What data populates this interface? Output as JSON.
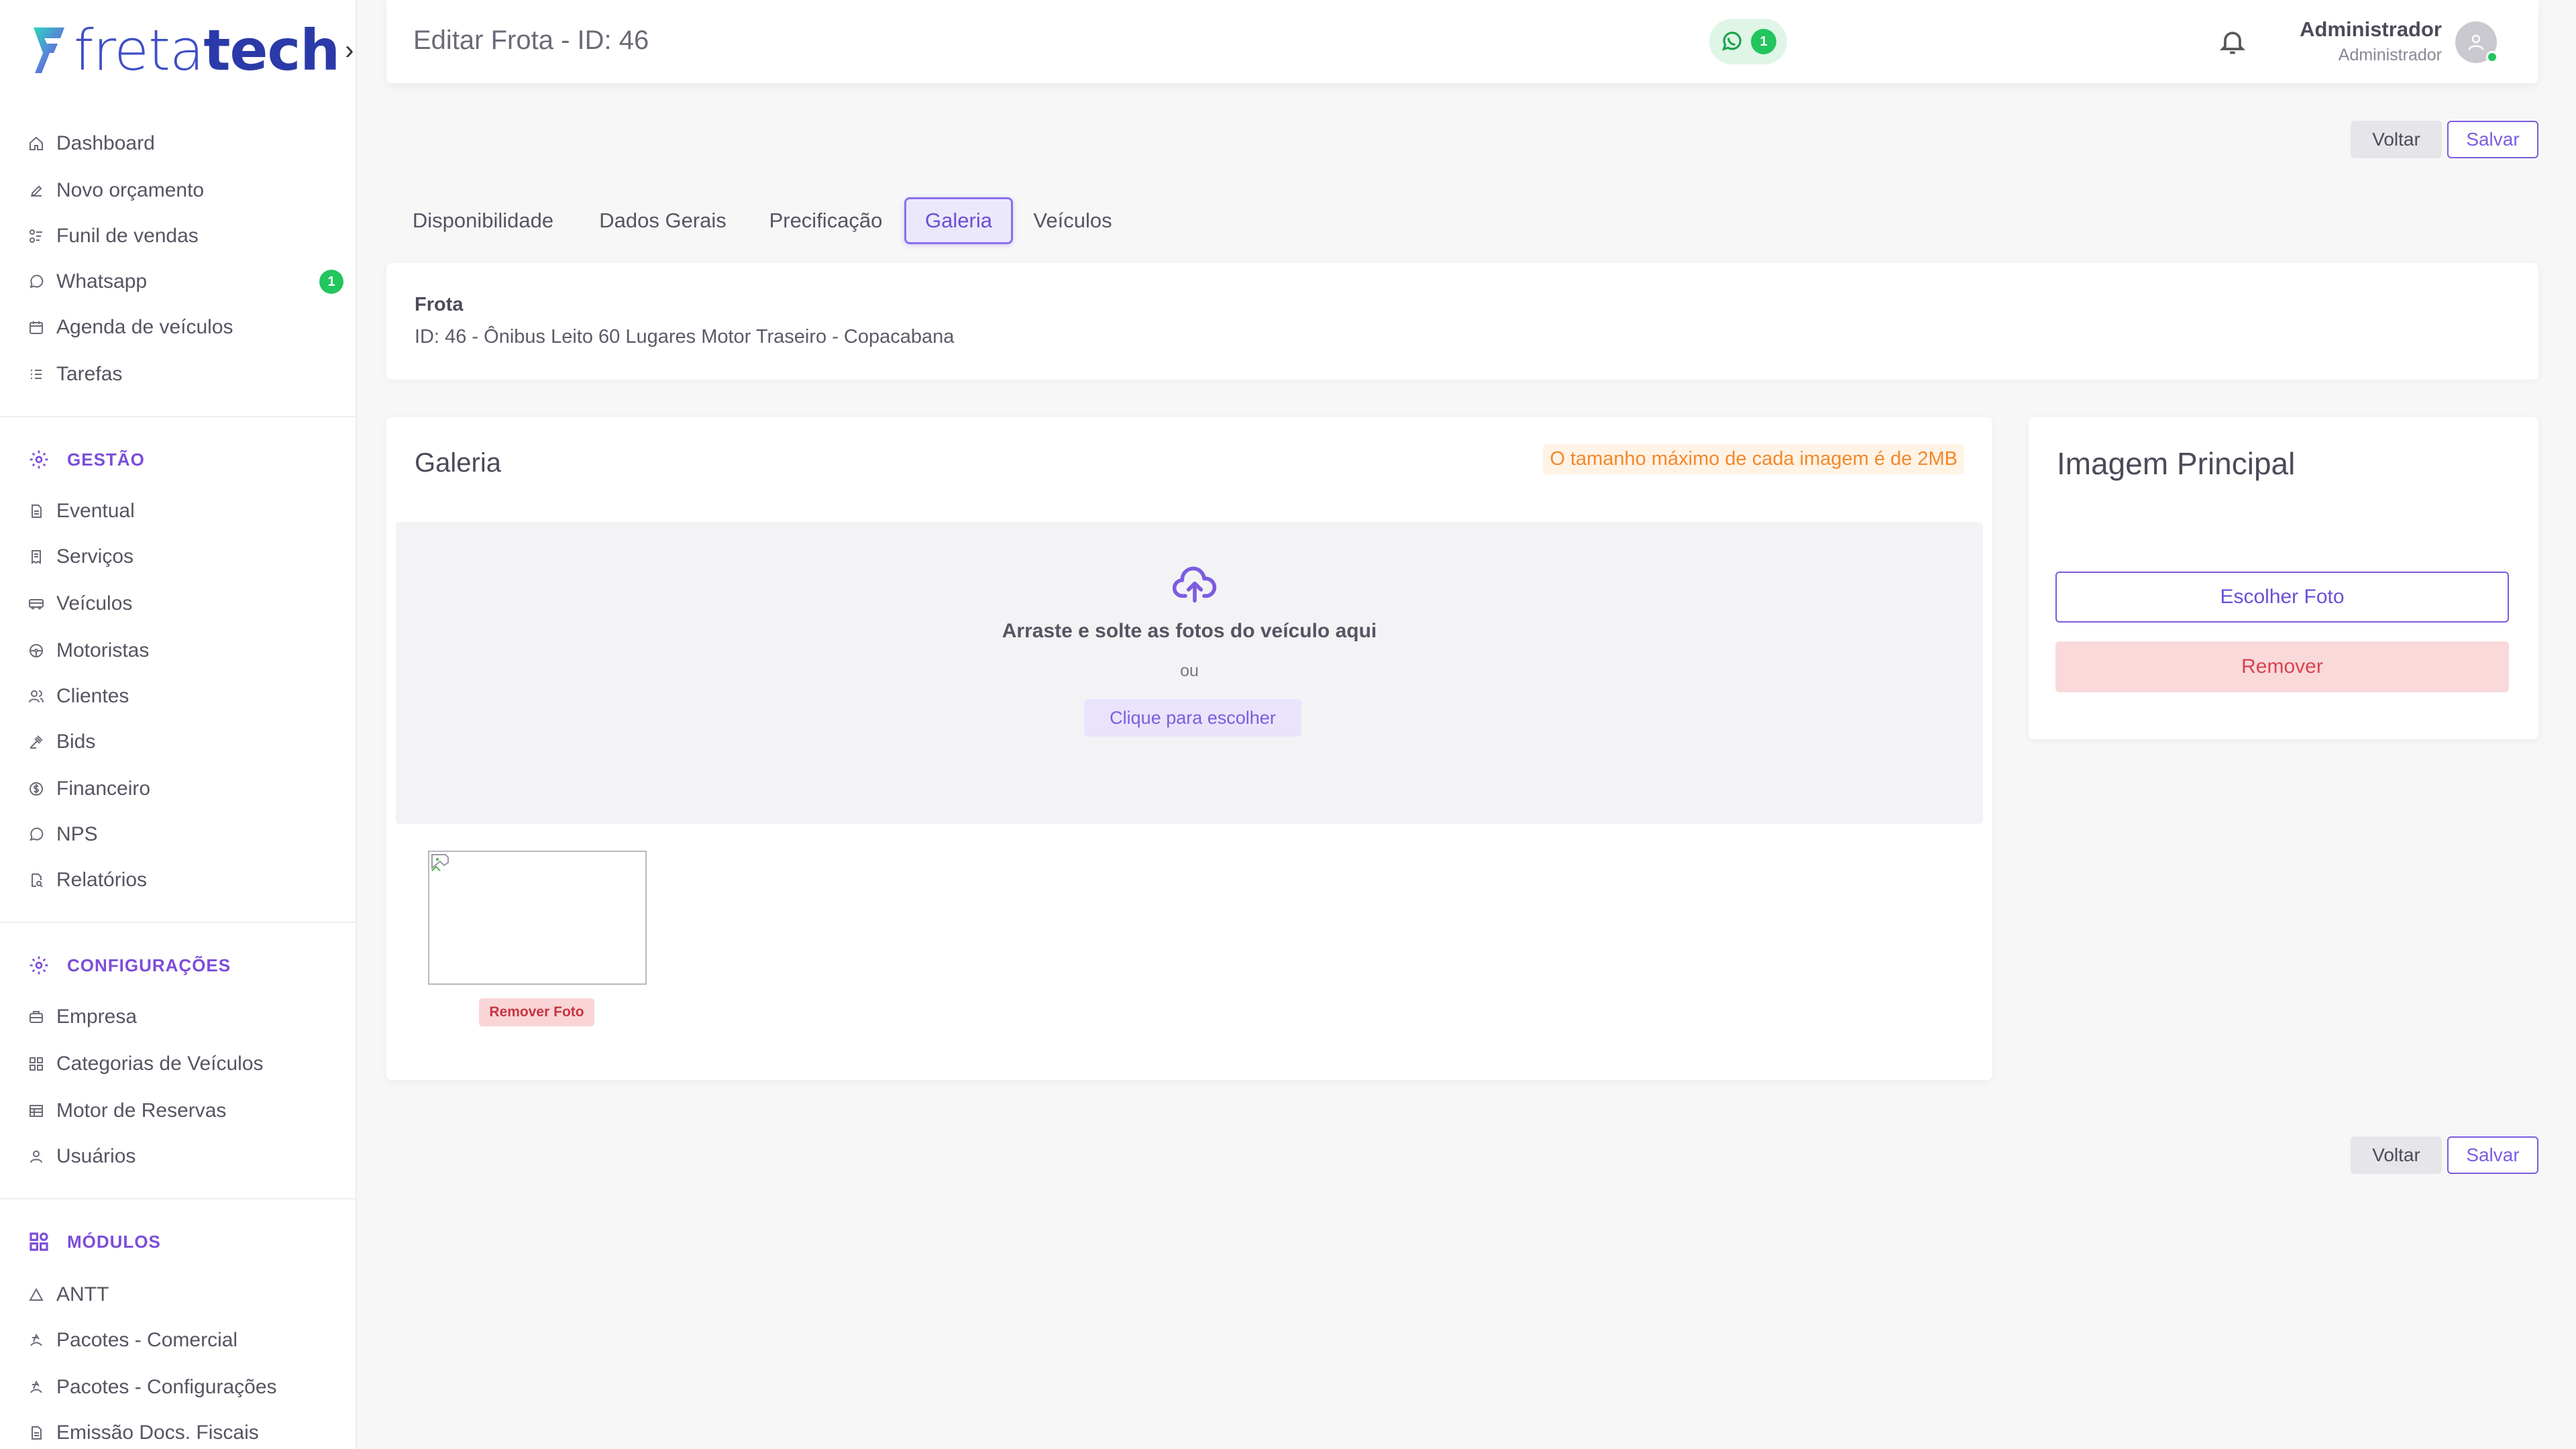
{
  "brand": {
    "logo_light": "freta",
    "logo_bold": "tech",
    "accent": "#7c5ce0"
  },
  "sidebar": {
    "items": [
      {
        "label": "Dashboard",
        "icon": "home-icon"
      },
      {
        "label": "Novo orçamento",
        "icon": "edit-icon"
      },
      {
        "label": "Funil de vendas",
        "icon": "funnel-icon"
      },
      {
        "label": "Whatsapp",
        "icon": "whatsapp-icon",
        "badge": "1"
      },
      {
        "label": "Agenda de veículos",
        "icon": "calendar-icon"
      },
      {
        "label": "Tarefas",
        "icon": "list-icon"
      }
    ],
    "sections": [
      {
        "title": "GESTÃO",
        "icon": "gear-icon",
        "items": [
          {
            "label": "Eventual",
            "icon": "document-icon"
          },
          {
            "label": "Serviços",
            "icon": "receipt-icon"
          },
          {
            "label": "Veículos",
            "icon": "bus-icon"
          },
          {
            "label": "Motoristas",
            "icon": "steering-wheel-icon"
          },
          {
            "label": "Clientes",
            "icon": "users-icon"
          },
          {
            "label": "Bids",
            "icon": "gavel-icon"
          },
          {
            "label": "Financeiro",
            "icon": "money-icon"
          },
          {
            "label": "NPS",
            "icon": "chat-icon"
          },
          {
            "label": "Relatórios",
            "icon": "report-icon"
          }
        ]
      },
      {
        "title": "CONFIGURAÇÕES",
        "icon": "gear-icon",
        "items": [
          {
            "label": "Empresa",
            "icon": "building-icon"
          },
          {
            "label": "Categorias de Veículos",
            "icon": "grid-icon"
          },
          {
            "label": "Motor de Reservas",
            "icon": "table-icon"
          },
          {
            "label": "Usuários",
            "icon": "user-icon"
          }
        ]
      },
      {
        "title": "MÓDULOS",
        "icon": "apps-icon",
        "items": [
          {
            "label": "ANTT",
            "icon": "triangle-icon"
          },
          {
            "label": "Pacotes - Comercial",
            "icon": "package-icon"
          },
          {
            "label": "Pacotes - Configurações",
            "icon": "package-icon"
          },
          {
            "label": "Emissão Docs. Fiscais",
            "icon": "document-icon"
          }
        ]
      }
    ]
  },
  "topbar": {
    "title": "Editar Frota - ID: 46",
    "whatsapp_count": "1",
    "user_name": "Administrador",
    "user_role": "Administrador"
  },
  "actions": {
    "back": "Voltar",
    "save": "Salvar"
  },
  "tabs": [
    {
      "label": "Disponibilidade",
      "active": false
    },
    {
      "label": "Dados Gerais",
      "active": false
    },
    {
      "label": "Precificação",
      "active": false
    },
    {
      "label": "Galeria",
      "active": true
    },
    {
      "label": "Veículos",
      "active": false
    }
  ],
  "frota": {
    "label": "Frota",
    "value": "ID: 46 - Ônibus Leito 60 Lugares Motor Traseiro - Copacabana"
  },
  "gallery": {
    "title": "Galeria",
    "note": "O tamanho máximo de cada imagem é de 2MB",
    "dropzone_text": "Arraste e solte as fotos do veículo aqui",
    "dropzone_or": "ou",
    "dropzone_button": "Clique para escolher",
    "remove_photo": "Remover Foto"
  },
  "main_image": {
    "title": "Imagem Principal",
    "choose": "Escolher Foto",
    "remove": "Remover"
  }
}
